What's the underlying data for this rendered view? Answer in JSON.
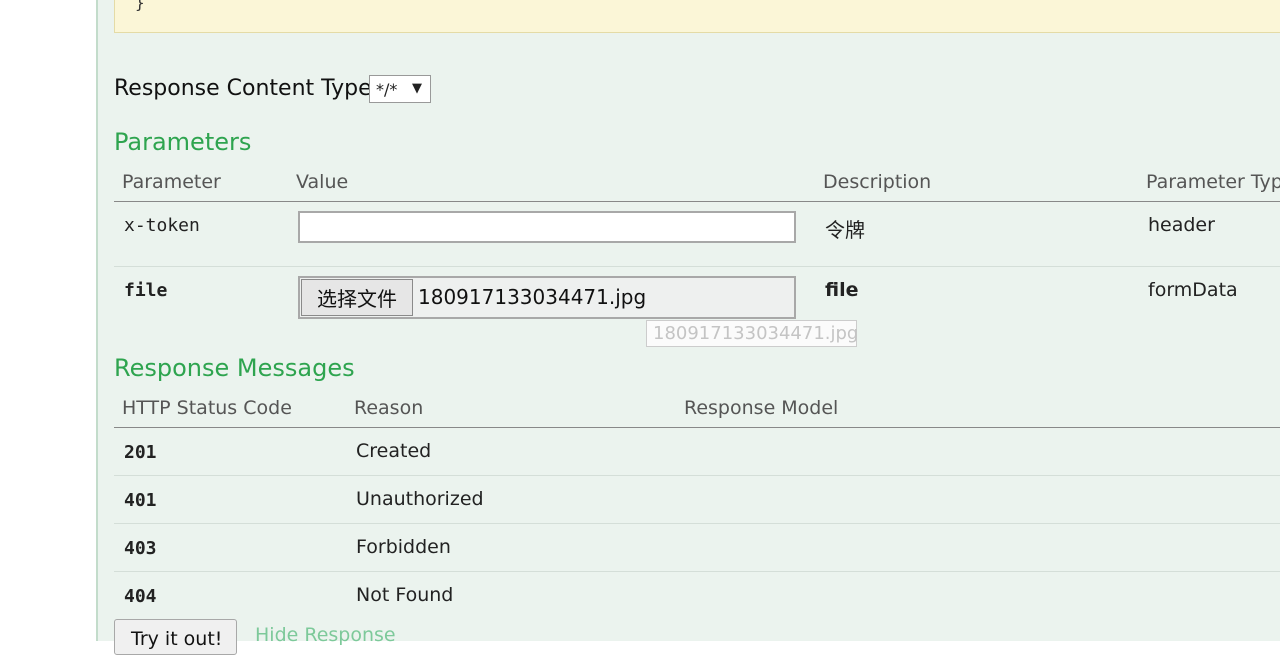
{
  "code_block": {
    "text": "}"
  },
  "response_content_type": {
    "label": "Response Content Type",
    "selected": "*/*"
  },
  "parameters": {
    "title": "Parameters",
    "headers": [
      "Parameter",
      "Value",
      "Description",
      "Parameter Typ"
    ],
    "rows": [
      {
        "name": "x-token",
        "value": "",
        "description": "令牌",
        "type": "header"
      },
      {
        "name": "file",
        "button_label": "选择文件",
        "file_name": "180917133034471.jpg",
        "description": "file",
        "type": "formData"
      }
    ],
    "tooltip": "180917133034471.jpg"
  },
  "response_messages": {
    "title": "Response Messages",
    "headers": [
      "HTTP Status Code",
      "Reason",
      "Response Model"
    ],
    "rows": [
      {
        "code": "201",
        "reason": "Created"
      },
      {
        "code": "401",
        "reason": "Unauthorized"
      },
      {
        "code": "403",
        "reason": "Forbidden"
      },
      {
        "code": "404",
        "reason": "Not Found"
      }
    ]
  },
  "actions": {
    "try_label": "Try it out!",
    "hide_label": "Hide Response"
  }
}
